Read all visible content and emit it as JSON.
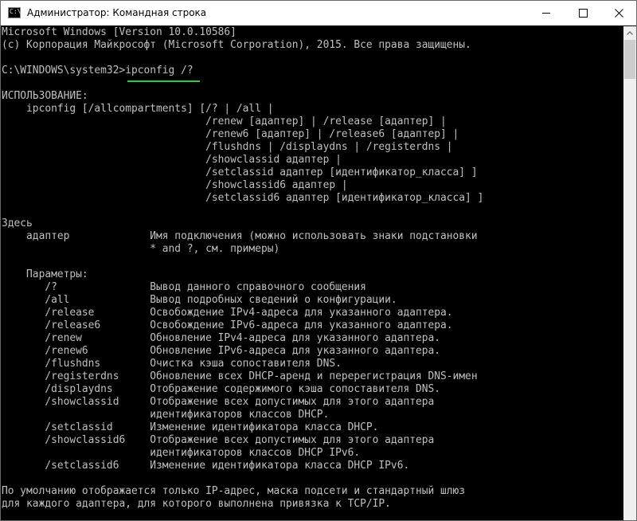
{
  "window": {
    "title": "Администратор: Командная строка",
    "icon_label": "C:\\.",
    "icon": "cmd-icon",
    "controls": [
      "minimize-icon",
      "maximize-icon",
      "close-icon"
    ]
  },
  "colors": {
    "console_bg": "#000000",
    "console_text": "#c0c0c0",
    "highlight_underline": "#2ecc40",
    "titlebar_bg": "#ffffff"
  },
  "console": {
    "lines": [
      "Microsoft Windows [Version 10.0.10586]",
      "(c) Корпорация Майкрософт (Microsoft Corporation), 2015. Все права защищены.",
      "",
      "C:\\WINDOWS\\system32>ipconfig /?",
      "",
      "ИСПОЛЬЗОВАНИЕ:",
      "    ipconfig [/allcompartments] [/? | /all |",
      "                                 /renew [адаптер] | /release [адаптер] |",
      "                                 /renew6 [адаптер] | /release6 [адаптер] |",
      "                                 /flushdns | /displaydns | /registerdns |",
      "                                 /showclassid адаптер |",
      "                                 /setclassid адаптер [идентификатор_класса] ]",
      "                                 /showclassid6 адаптер |",
      "                                 /setclassid6 адаптер [идентификатор_класса] ]",
      "",
      "Здесь",
      "    адаптер             Имя подключения (можно использовать знаки подстановки",
      "                        * and ?, см. примеры)",
      "",
      "    Параметры:",
      "       /?               Вывод данного справочного сообщения",
      "       /all             Вывод подробных сведений о конфигурации.",
      "       /release         Освобождение IPv4-адреса для указанного адаптера.",
      "       /release6        Освобождение IPv6-адреса для указанного адаптера.",
      "       /renew           Обновление IPv4-адреса для указанного адаптера.",
      "       /renew6          Обновление IPv6-адреса для указанного адаптера.",
      "       /flushdns        Очистка кэша сопоставителя DNS.",
      "       /registerdns     Обновление всех DHCP-аренд и перерегистрация DNS-имен",
      "       /displaydns      Отображение содержимого кэша сопоставителя DNS.",
      "       /showclassid     Отображение всех допустимых для этого адаптера",
      "                        идентификаторов классов DHCP.",
      "       /setclassid      Изменение идентификатора класса DHCP.",
      "       /showclassid6    Отображение всех допустимых для этого адаптера",
      "                        идентификаторов классов DHCP IPv6.",
      "       /setclassid6     Изменение идентификатора класса DHCP IPv6.",
      "",
      "По умолчанию отображается только IP-адрес, маска подсети и стандартный шлюз",
      "для каждого адаптера, для которого выполнена привязка к TCP/IP."
    ]
  },
  "scrollbar": {
    "up_icon": "scroll-up-arrow-icon"
  }
}
